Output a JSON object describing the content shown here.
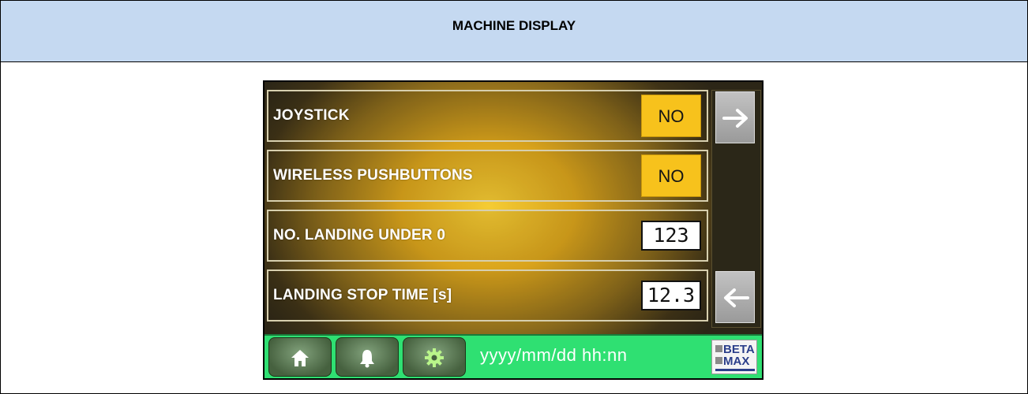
{
  "document": {
    "header": "MACHINE DISPLAY"
  },
  "screen": {
    "rows": [
      {
        "label": "JOYSTICK",
        "value": "NO",
        "kind": "yes-no"
      },
      {
        "label": "WIRELESS PUSHBUTTONS",
        "value": "NO",
        "kind": "yes-no"
      },
      {
        "label": "NO. LANDING UNDER 0",
        "value": "123",
        "kind": "number"
      },
      {
        "label": "LANDING STOP TIME [s]",
        "value": "12.3",
        "kind": "number"
      }
    ],
    "nav": {
      "next_icon": "arrow-right-icon",
      "prev_icon": "arrow-left-icon"
    },
    "status_bar": {
      "buttons": [
        {
          "icon": "home-icon"
        },
        {
          "icon": "bell-icon"
        },
        {
          "icon": "gear-icon"
        }
      ],
      "datetime": "yyyy/mm/dd hh:nn",
      "logo": {
        "line1": "BETA",
        "line2": "MAX"
      }
    },
    "colors": {
      "yes_no_fill": "#f7c21c",
      "status_bar": "#2fe072",
      "panel_glow": "#f5cc34"
    }
  }
}
